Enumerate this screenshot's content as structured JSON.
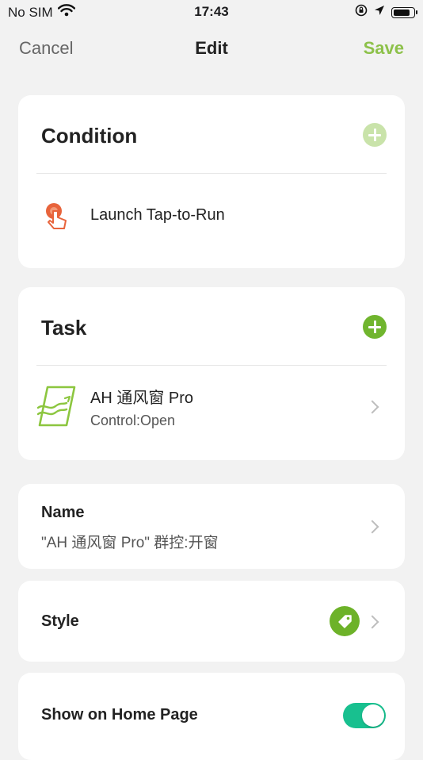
{
  "status_bar": {
    "carrier": "No SIM",
    "time": "17:43"
  },
  "nav": {
    "cancel_label": "Cancel",
    "title": "Edit",
    "save_label": "Save"
  },
  "condition": {
    "title": "Condition",
    "item_label": "Launch Tap-to-Run",
    "icon": "tap-hand-icon"
  },
  "task": {
    "title": "Task",
    "device_name": "AH 通风窗 Pro",
    "device_action": "Control:Open",
    "icon": "window-device-icon"
  },
  "name_row": {
    "label": "Name",
    "value": "\"AH 通风窗 Pro\" 群控:开窗"
  },
  "style_row": {
    "label": "Style",
    "icon": "tag-icon"
  },
  "home_row": {
    "label": "Show on Home Page",
    "enabled": true
  },
  "colors": {
    "accent_green": "#70b52e",
    "save_green": "#8dc14a",
    "toggle_green": "#18c08f",
    "tap_orange": "#e8643c"
  }
}
